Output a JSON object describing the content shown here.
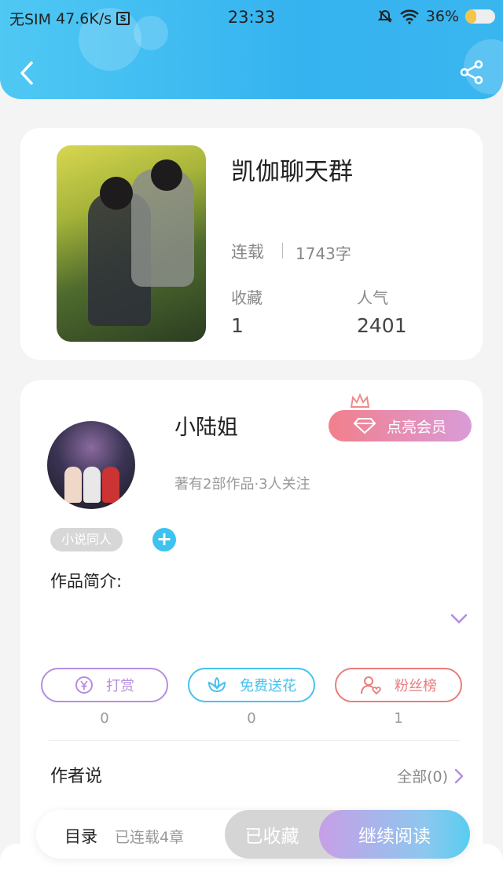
{
  "status_bar": {
    "carrier": "无SIM",
    "speed": "47.6K/s",
    "sim_badge": "S",
    "time": "23:33",
    "battery_percent": "36%",
    "battery_level": 0.36
  },
  "header": {
    "back_icon": "chevron-left-icon",
    "share_icon": "share-icon"
  },
  "book": {
    "title": "凯伽聊天群",
    "status": "连载",
    "word_count": "1743字",
    "favorites_label": "收藏",
    "favorites_value": "1",
    "popularity_label": "人气",
    "popularity_value": "2401"
  },
  "author": {
    "name": "小陆姐",
    "meta": "著有2部作品·3人关注",
    "vip_button": "点亮会员",
    "tag": "小说同人",
    "intro_label": "作品简介:"
  },
  "actions": [
    {
      "label": "打赏",
      "count": "0",
      "icon": "yen-coin-icon",
      "color": "#b68de0"
    },
    {
      "label": "免费送花",
      "count": "0",
      "icon": "flower-icon",
      "color": "#46c1ef"
    },
    {
      "label": "粉丝榜",
      "count": "1",
      "icon": "fan-heart-icon",
      "color": "#ea7c7c"
    }
  ],
  "author_says": {
    "title": "作者说",
    "all_link": "全部(0)"
  },
  "bottom_bar": {
    "toc": "目录",
    "chapters": "已连载4章",
    "collected": "已收藏",
    "continue": "继续阅读"
  }
}
